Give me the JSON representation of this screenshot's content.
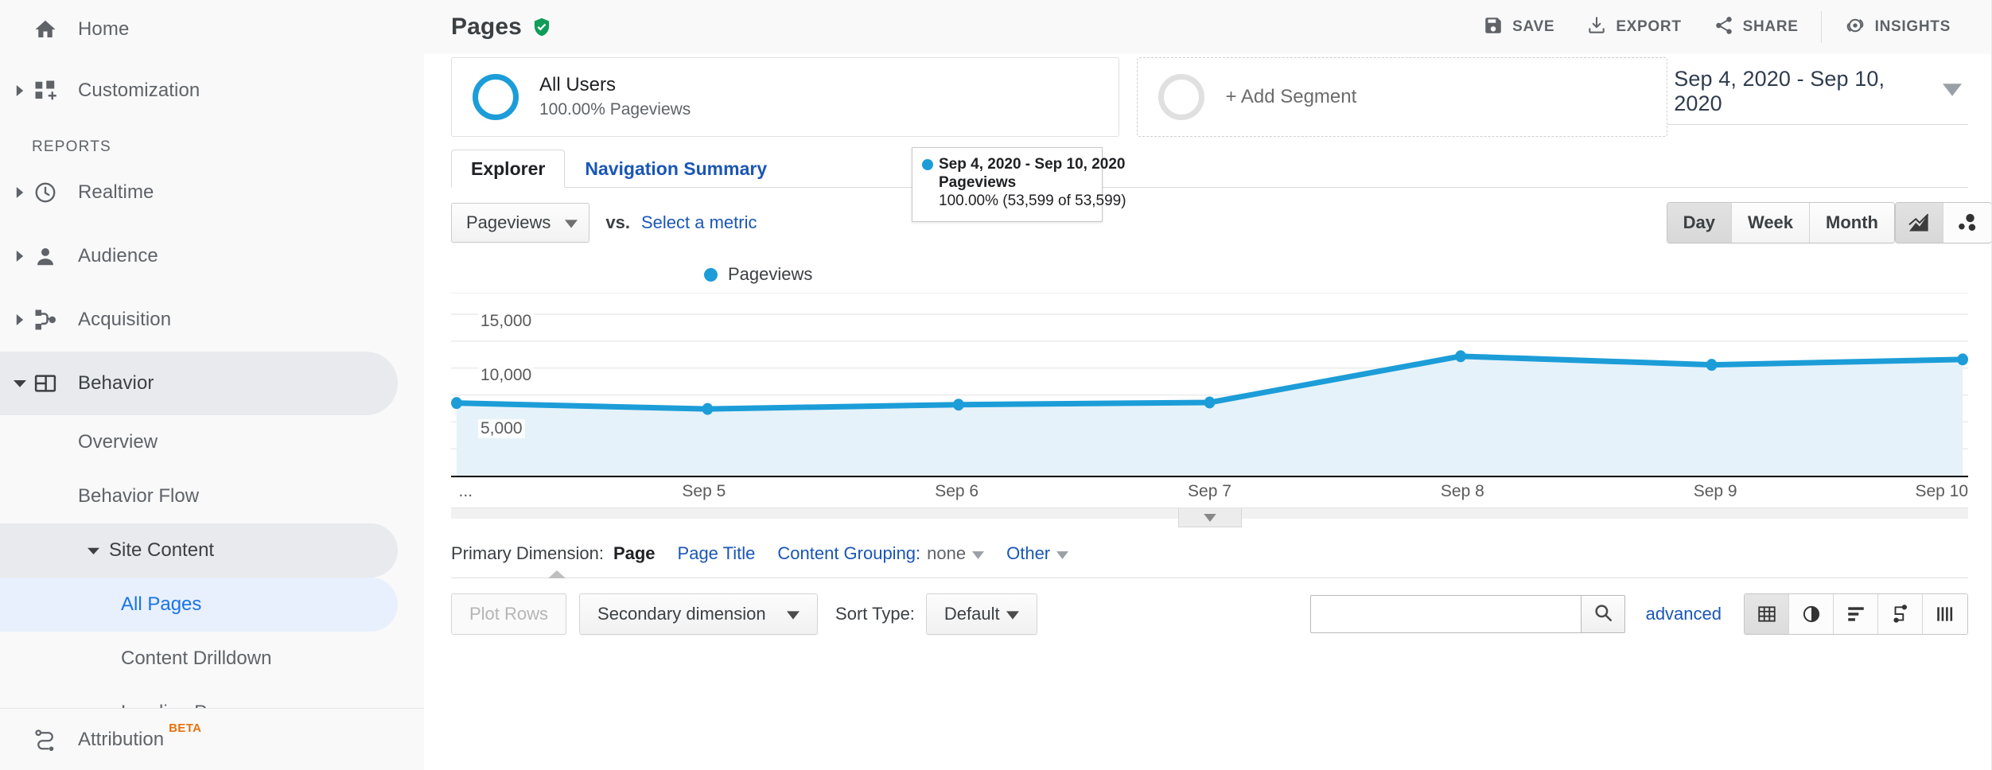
{
  "sidebar": {
    "home": {
      "label": "Home",
      "icon": "home-icon"
    },
    "customization": {
      "label": "Customization",
      "icon": "customization-icon"
    },
    "reports_header": "REPORTS",
    "reports": [
      {
        "label": "Realtime",
        "icon": "clock-icon"
      },
      {
        "label": "Audience",
        "icon": "person-icon"
      },
      {
        "label": "Acquisition",
        "icon": "acquisition-icon"
      },
      {
        "label": "Behavior",
        "icon": "behavior-icon"
      }
    ],
    "behavior_children": [
      {
        "label": "Overview"
      },
      {
        "label": "Behavior Flow"
      }
    ],
    "site_content": {
      "label": "Site Content"
    },
    "site_content_children": [
      {
        "label": "All Pages"
      },
      {
        "label": "Content Drilldown"
      },
      {
        "label": "Landing Pages"
      }
    ],
    "attribution": {
      "label": "Attribution",
      "badge": "BETA",
      "icon": "attribution-icon"
    }
  },
  "header": {
    "title": "Pages",
    "verified_icon": "verified-shield-icon",
    "actions": [
      {
        "label": "SAVE",
        "icon": "save-icon"
      },
      {
        "label": "EXPORT",
        "icon": "export-icon"
      },
      {
        "label": "SHARE",
        "icon": "share-icon"
      },
      {
        "label": "INSIGHTS",
        "icon": "insights-icon"
      }
    ]
  },
  "segments": {
    "all_users": {
      "name": "All Users",
      "sub": "100.00% Pageviews"
    },
    "add_segment": {
      "label": "+ Add Segment"
    }
  },
  "date_range": {
    "value": "Sep 4, 2020 - Sep 10, 2020",
    "icon": "chevron-down-icon"
  },
  "tabs": [
    {
      "label": "Explorer",
      "active": true
    },
    {
      "label": "Navigation Summary",
      "active": false
    }
  ],
  "metric_controls": {
    "metric_select": "Pageviews",
    "vs": "vs.",
    "select_metric": "Select a metric",
    "granularity": [
      {
        "label": "Day",
        "active": true
      },
      {
        "label": "Week",
        "active": false
      },
      {
        "label": "Month",
        "active": false
      }
    ],
    "chart_types": [
      {
        "icon": "line-chart-icon",
        "active": true
      },
      {
        "icon": "scatter-chart-icon",
        "active": false
      }
    ]
  },
  "tooltip": {
    "date": "Sep 4, 2020 - Sep 10, 2020",
    "metric": "Pageviews",
    "value": "100.00% (53,599 of 53,599)"
  },
  "legend": {
    "label": "Pageviews",
    "color": "#1c9dd8"
  },
  "primary_dimension": {
    "label": "Primary Dimension:",
    "active": "Page",
    "page_title": "Page Title",
    "content_grouping_label": "Content Grouping:",
    "content_grouping_value": "none",
    "other": "Other"
  },
  "table_toolbar": {
    "plot_rows": "Plot Rows",
    "secondary_dimension": "Secondary dimension",
    "sort_type_label": "Sort Type:",
    "sort_type_value": "Default",
    "search_placeholder": "",
    "search_value": "",
    "search_icon": "search-icon",
    "advanced": "advanced",
    "view_modes": [
      {
        "icon": "table-view-icon",
        "active": true
      },
      {
        "icon": "pie-view-icon",
        "active": false
      },
      {
        "icon": "bar-view-icon",
        "active": false
      },
      {
        "icon": "performance-view-icon",
        "active": false
      },
      {
        "icon": "pivot-view-icon",
        "active": false
      }
    ]
  },
  "chart_data": {
    "type": "line",
    "title": "Pageviews",
    "xlabel": "",
    "ylabel": "Pageviews",
    "x": [
      "...",
      "Sep 5",
      "Sep 6",
      "Sep 7",
      "Sep 8",
      "Sep 9",
      "Sep 10"
    ],
    "tick_labels": [
      "...",
      "Sep 5",
      "Sep 6",
      "Sep 7",
      "Sep 8",
      "Sep 9",
      "Sep 10"
    ],
    "series": [
      {
        "name": "Pageviews",
        "color": "#1c9dd8",
        "values": [
          6750,
          6200,
          6600,
          6800,
          11100,
          10300,
          10800
        ]
      }
    ],
    "ylim": [
      0,
      17000
    ],
    "yticks": [
      5000,
      10000,
      15000
    ],
    "ytick_labels": [
      "5,000",
      "10,000",
      "15,000"
    ],
    "grid": true,
    "area_fill": "#e6f2f9",
    "total": "53,599",
    "legend_position": "top-left"
  }
}
